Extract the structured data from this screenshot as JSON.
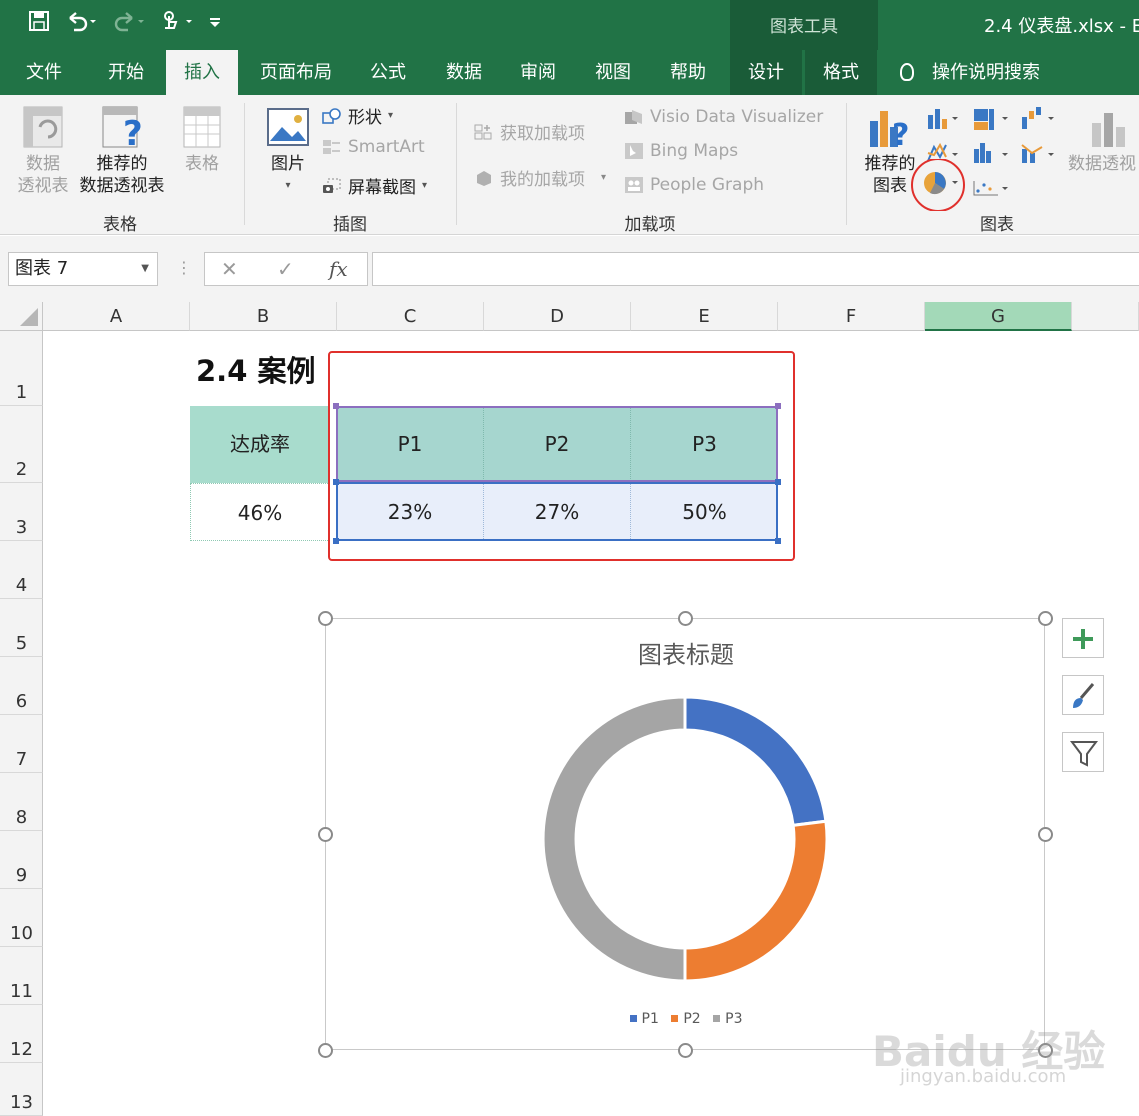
{
  "titlebar": {
    "chart_tools": "图表工具",
    "doc_title": "2.4 仪表盘.xlsx  -  E"
  },
  "tabs": [
    "文件",
    "开始",
    "插入",
    "页面布局",
    "公式",
    "数据",
    "审阅",
    "视图",
    "帮助",
    "设计",
    "格式"
  ],
  "tell_me": "操作说明搜索",
  "ribbon": {
    "tables": {
      "pivot": [
        "数据",
        "透视表"
      ],
      "recommended_pivot": [
        "推荐的",
        "数据透视表"
      ],
      "table": "表格",
      "label": "表格"
    },
    "illustrations": {
      "picture": "图片",
      "shapes": "形状",
      "smartart": "SmartArt",
      "screenshot": "屏幕截图",
      "label": "插图"
    },
    "addins": {
      "get": "获取加载项",
      "my": "我的加载项",
      "visio": "Visio Data Visualizer",
      "bing": "Bing Maps",
      "people": "People Graph",
      "label": "加载项"
    },
    "charts": {
      "recommended": [
        "推荐的",
        "图表"
      ],
      "pivot_chart": [
        "数据透视",
        ""
      ],
      "label": "图表"
    }
  },
  "formula_bar": {
    "name_box": "图表 7",
    "fx": "fx"
  },
  "columns": [
    "A",
    "B",
    "C",
    "D",
    "E",
    "F",
    "G"
  ],
  "rows": [
    "1",
    "2",
    "3",
    "4",
    "5",
    "6",
    "7",
    "8",
    "9",
    "10",
    "11",
    "12",
    "13"
  ],
  "sheet": {
    "title": "2.4 案例",
    "b2": "达成率",
    "b3": "46%",
    "headers": [
      "P1",
      "P2",
      "P3"
    ],
    "values": [
      "23%",
      "27%",
      "50%"
    ]
  },
  "chart_data": {
    "type": "pie",
    "variant": "doughnut",
    "title": "图表标题",
    "categories": [
      "P1",
      "P2",
      "P3"
    ],
    "values": [
      0.23,
      0.27,
      0.5
    ],
    "colors": [
      "#4472c4",
      "#ed7d31",
      "#a5a5a5"
    ],
    "legend": "bottom"
  },
  "watermark": {
    "main": "Baidu 经验",
    "sub": "jingyan.baidu.com"
  }
}
